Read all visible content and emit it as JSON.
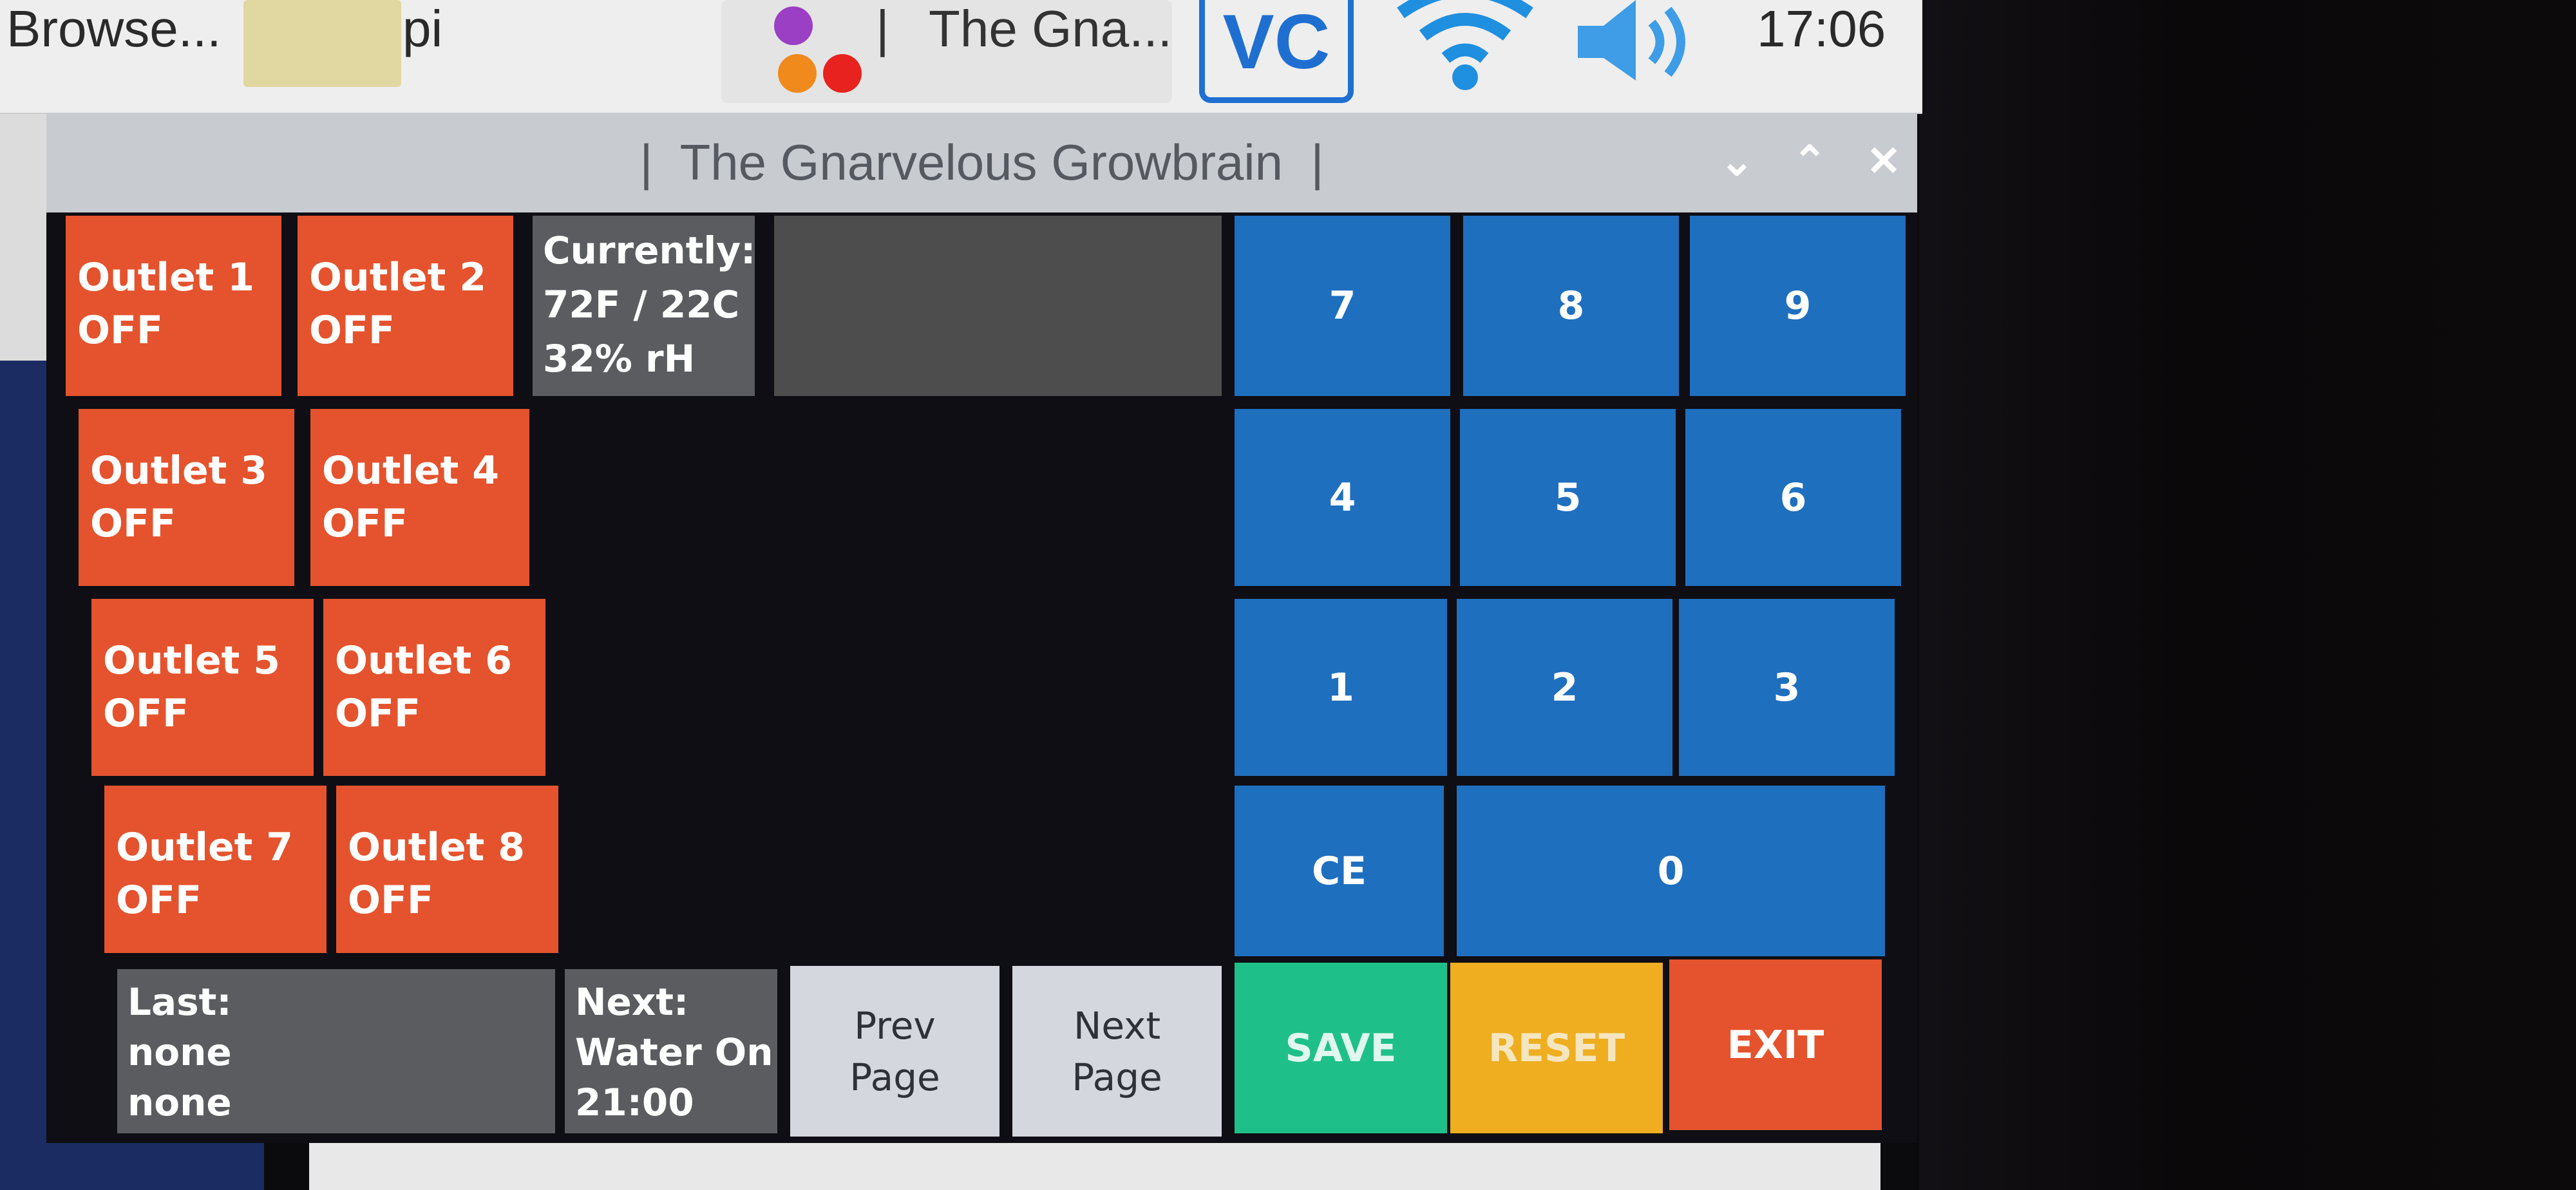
{
  "taskbar": {
    "browser_label": "Browse...",
    "files_label": "pi",
    "window_button_label": "The Gna...",
    "vnc_label": "VC",
    "clock": "17:06"
  },
  "window": {
    "title": "|  The Gnarvelous Growbrain  |"
  },
  "outlets": [
    {
      "name": "Outlet 1",
      "state": "OFF"
    },
    {
      "name": "Outlet 2",
      "state": "OFF"
    },
    {
      "name": "Outlet 3",
      "state": "OFF"
    },
    {
      "name": "Outlet 4",
      "state": "OFF"
    },
    {
      "name": "Outlet 5",
      "state": "OFF"
    },
    {
      "name": "Outlet 6",
      "state": "OFF"
    },
    {
      "name": "Outlet 7",
      "state": "OFF"
    },
    {
      "name": "Outlet 8",
      "state": "OFF"
    }
  ],
  "status": {
    "current_label": "Currently:",
    "temperature": "72F / 22C",
    "humidity": "32% rH",
    "last_label": "Last:",
    "last_line1": "none",
    "last_line2": "none",
    "next_label": "Next:",
    "next_event": "Water On",
    "next_time": "21:00"
  },
  "keypad": [
    "7",
    "8",
    "9",
    "4",
    "5",
    "6",
    "1",
    "2",
    "3",
    "CE",
    "0"
  ],
  "nav": {
    "prev_line1": "Prev",
    "prev_line2": "Page",
    "next_line1": "Next",
    "next_line2": "Page"
  },
  "actions": {
    "save": "SAVE",
    "reset": "RESET",
    "exit": "EXIT"
  },
  "colors": {
    "outlet_off": "#e4532d",
    "keypad": "#1f6fbf",
    "save": "#1fbf8a",
    "reset": "#eeae1f",
    "exit": "#e4532d"
  }
}
